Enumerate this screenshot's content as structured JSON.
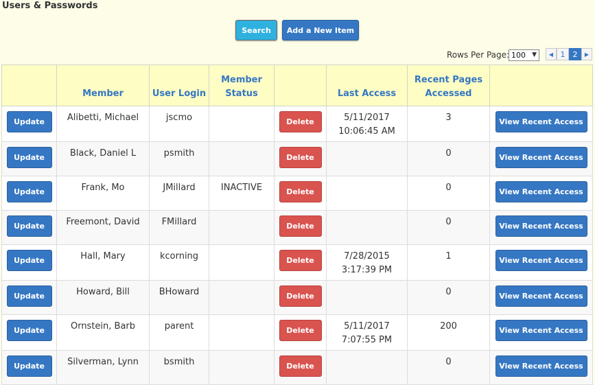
{
  "page_title": "Users & Passwords",
  "toolbar": {
    "search_label": "Search",
    "add_label": "Add a New Item"
  },
  "pager": {
    "rows_label": "Rows Per Page:",
    "rows_value": "100",
    "prev_icon": "◀",
    "next_icon": "▶",
    "pages": [
      "1",
      "2"
    ],
    "current_page": "2"
  },
  "table": {
    "headers": [
      "",
      "Member",
      "User Login",
      "Member Status",
      "",
      "Last Access",
      "Recent Pages Accessed",
      ""
    ],
    "update_label": "Update",
    "delete_label": "Delete",
    "view_label": "View Recent Access",
    "rows": [
      {
        "member": "Alibetti, Michael",
        "login": "jscmo",
        "status": "",
        "last_date": "5/11/2017",
        "last_time": "10:06:45 AM",
        "pages": "3"
      },
      {
        "member": "Black, Daniel L",
        "login": "psmith",
        "status": "",
        "last_date": "",
        "last_time": "",
        "pages": "0"
      },
      {
        "member": "Frank, Mo",
        "login": "JMillard",
        "status": "INACTIVE",
        "last_date": "",
        "last_time": "",
        "pages": "0"
      },
      {
        "member": "Freemont, David",
        "login": "FMillard",
        "status": "",
        "last_date": "",
        "last_time": "",
        "pages": "0"
      },
      {
        "member": "Hall, Mary",
        "login": "kcorning",
        "status": "",
        "last_date": "7/28/2015",
        "last_time": "3:17:39 PM",
        "pages": "1"
      },
      {
        "member": "Howard, Bill",
        "login": "BHoward",
        "status": "",
        "last_date": "",
        "last_time": "",
        "pages": "0"
      },
      {
        "member": "Ornstein, Barb",
        "login": "parent",
        "status": "",
        "last_date": "5/11/2017",
        "last_time": "7:07:55 PM",
        "pages": "200"
      },
      {
        "member": "Silverman, Lynn",
        "login": "bsmith",
        "status": "",
        "last_date": "",
        "last_time": "",
        "pages": "0"
      }
    ]
  },
  "colors": {
    "background": "#fdfde8",
    "header_bg": "#fdfdc4",
    "accent_blue": "#3577c3",
    "search_cyan": "#2fb1df",
    "delete_red": "#d9534f"
  }
}
